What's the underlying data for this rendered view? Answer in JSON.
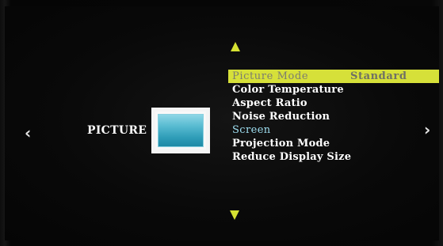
{
  "menu": {
    "category": "PICTURE",
    "icon": "picture-icon",
    "navigation": {
      "up": "up-arrow",
      "down": "down-arrow",
      "left": "‹",
      "right": "›"
    },
    "items": [
      {
        "label": "Picture Mode",
        "value": "Standard",
        "state": "selected"
      },
      {
        "label": "Color Temperature",
        "state": "normal"
      },
      {
        "label": "Aspect Ratio",
        "state": "normal"
      },
      {
        "label": "Noise Reduction",
        "state": "normal"
      },
      {
        "label": "Screen",
        "state": "disabled"
      },
      {
        "label": "Projection Mode",
        "state": "normal"
      },
      {
        "label": "Reduce Display Size",
        "state": "normal"
      }
    ]
  },
  "colors": {
    "background": "#070707",
    "highlight": "#d6e039",
    "highlight_text": "#7c7d70",
    "menu_text": "#ffffff",
    "disabled_text": "#9fdff1",
    "arrow": "#d5e132",
    "icon_fill": "#58bbd1"
  }
}
